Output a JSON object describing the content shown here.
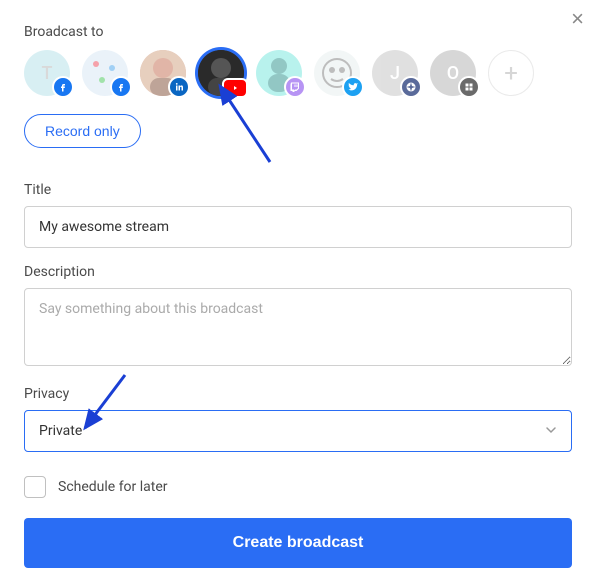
{
  "header": {
    "broadcast_to_label": "Broadcast to"
  },
  "destinations": [
    {
      "name": "T",
      "bg": "#bae3ea",
      "fg": "#bbb",
      "badge": "facebook",
      "selected": false
    },
    {
      "name": "",
      "bg": "#d9e9f5",
      "fg": "#fff",
      "badge": "facebook",
      "selected": false,
      "pattern": "dots"
    },
    {
      "name": "",
      "bg": "#c97a60",
      "fg": "#fff",
      "badge": "linkedin",
      "selected": false,
      "pattern": "face1"
    },
    {
      "name": "",
      "bg": "#333333",
      "fg": "#fff",
      "badge": "youtube",
      "selected": true,
      "pattern": "face2"
    },
    {
      "name": "",
      "bg": "#7fe8e0",
      "fg": "#fff",
      "badge": "twitch",
      "selected": false,
      "pattern": "silhouette"
    },
    {
      "name": "",
      "bg": "#e8f0f0",
      "fg": "#888",
      "badge": "twitter",
      "selected": false,
      "pattern": "robot"
    },
    {
      "name": "J",
      "bg": "#c8c8c8",
      "fg": "#fff",
      "badge": "custom1",
      "selected": false
    },
    {
      "name": "O",
      "bg": "#b8b8b8",
      "fg": "#fff",
      "badge": "custom2",
      "selected": false
    }
  ],
  "record_only_label": "Record only",
  "title": {
    "label": "Title",
    "value": "My awesome stream"
  },
  "description": {
    "label": "Description",
    "placeholder": "Say something about this broadcast"
  },
  "privacy": {
    "label": "Privacy",
    "value": "Private"
  },
  "schedule": {
    "label": "Schedule for later",
    "checked": false
  },
  "create_button_label": "Create broadcast",
  "colors": {
    "primary": "#2a6df4",
    "facebook": "#1877f2",
    "linkedin": "#0a66c2",
    "youtube": "#ff0000",
    "twitch": "#b794f4",
    "twitter": "#1da1f2"
  }
}
